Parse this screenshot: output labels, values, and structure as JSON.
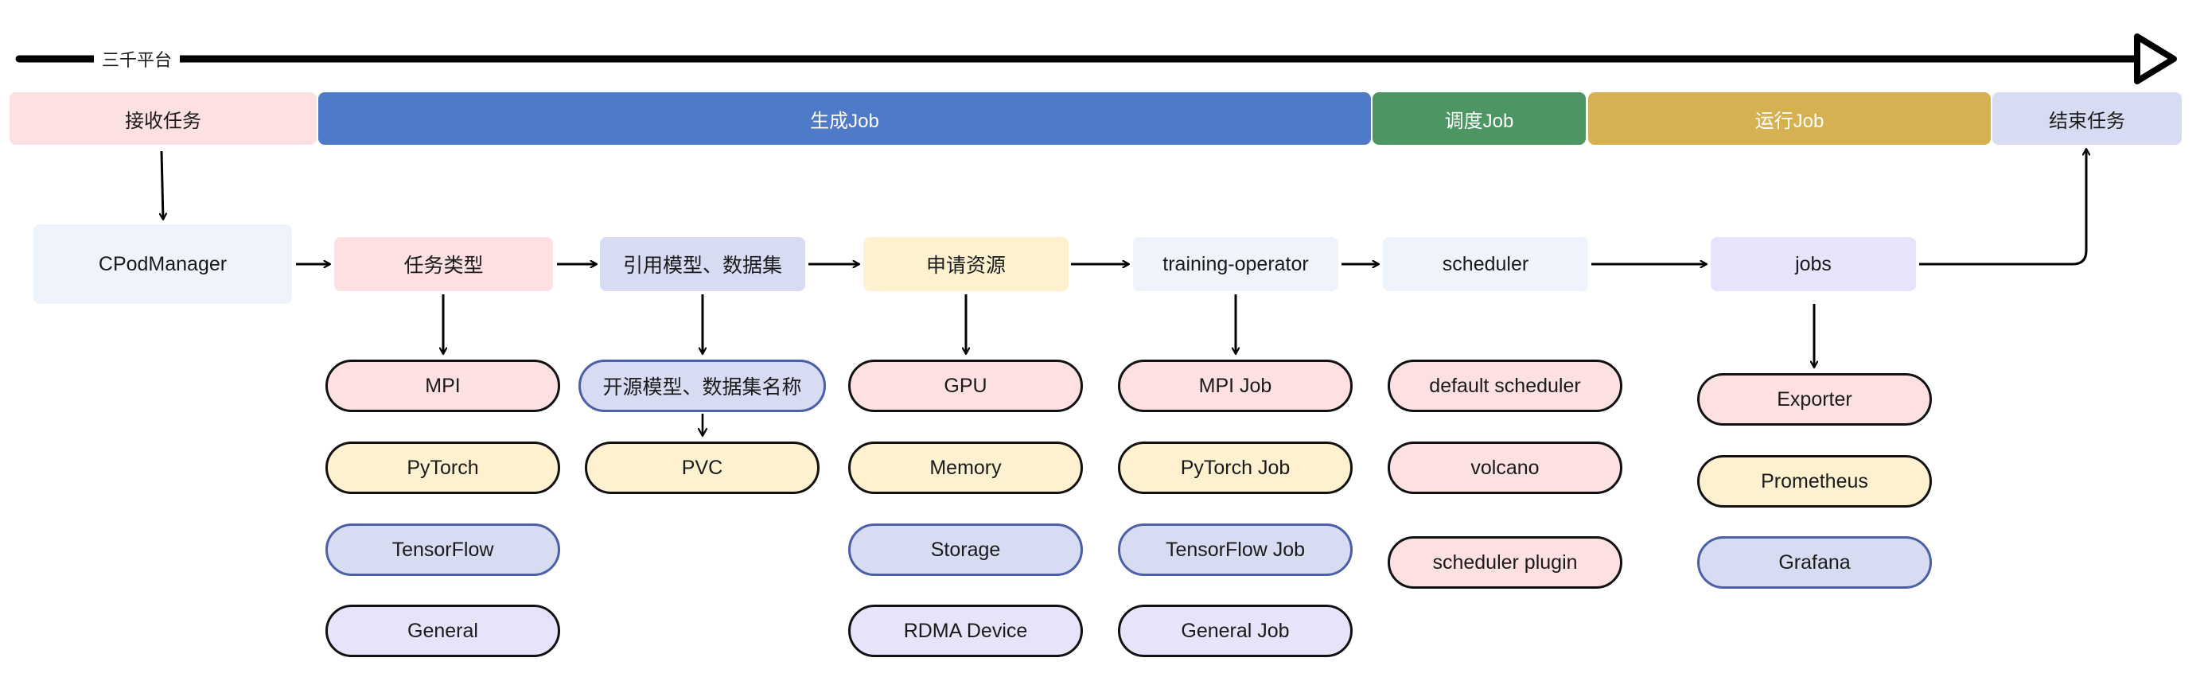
{
  "timeline": {
    "title": "三千平台"
  },
  "stages": [
    {
      "label": "接收任务",
      "bg": "#fde0e2",
      "fg": "#1a1a1a"
    },
    {
      "label": "生成Job",
      "bg": "#4f7ac8",
      "fg": "#ffffff"
    },
    {
      "label": "调度Job",
      "bg": "#4e9564",
      "fg": "#ffffff"
    },
    {
      "label": "运行Job",
      "bg": "#d5b152",
      "fg": "#ffffff"
    },
    {
      "label": "结束任务",
      "bg": "#d7dcf3",
      "fg": "#1a1a1a"
    }
  ],
  "main_nodes": [
    {
      "label": "CPodManager",
      "bg": "#eef3fc"
    },
    {
      "label": "任务类型",
      "bg": "#fde0e2"
    },
    {
      "label": "引用模型、数据集",
      "bg": "#d7dcf3"
    },
    {
      "label": "申请资源",
      "bg": "#fdf1cf"
    },
    {
      "label": "training-operator",
      "bg": "#eef3fc"
    },
    {
      "label": "scheduler",
      "bg": "#eef3fc"
    },
    {
      "label": "jobs",
      "bg": "#e9e2fb"
    }
  ],
  "columns": [
    {
      "items": [
        {
          "label": "MPI",
          "bg": "#fde0e2"
        },
        {
          "label": "PyTorch",
          "bg": "#fdf1cf"
        },
        {
          "label": "TensorFlow",
          "bg": "#d7dcf3"
        },
        {
          "label": "General",
          "bg": "#e9e2fb"
        }
      ]
    },
    {
      "items": [
        {
          "label": "开源模型、数据集名称",
          "bg": "#d7dcf3"
        },
        {
          "label": "PVC",
          "bg": "#fdf1cf"
        }
      ]
    },
    {
      "items": [
        {
          "label": "GPU",
          "bg": "#fde0e2"
        },
        {
          "label": "Memory",
          "bg": "#fdf1cf"
        },
        {
          "label": "Storage",
          "bg": "#d7dcf3"
        },
        {
          "label": "RDMA Device",
          "bg": "#e9e2fb"
        }
      ]
    },
    {
      "items": [
        {
          "label": "MPI Job",
          "bg": "#fde0e2"
        },
        {
          "label": "PyTorch Job",
          "bg": "#fdf1cf"
        },
        {
          "label": "TensorFlow Job",
          "bg": "#d7dcf3"
        },
        {
          "label": "General Job",
          "bg": "#e9e2fb"
        }
      ]
    },
    {
      "items": [
        {
          "label": "default scheduler",
          "bg": "#fde0e2"
        },
        {
          "label": "volcano",
          "bg": "#fde0e2"
        },
        {
          "label": "scheduler plugin",
          "bg": "#fde0e2"
        }
      ]
    },
    {
      "items": [
        {
          "label": "Exporter",
          "bg": "#fde0e2"
        },
        {
          "label": "Prometheus",
          "bg": "#fdf1cf"
        },
        {
          "label": "Grafana",
          "bg": "#d7dcf3"
        }
      ]
    }
  ],
  "colors": {
    "line": "#000000",
    "pill_border": "#111111",
    "pill_border_blue": "#4a5fa6"
  }
}
